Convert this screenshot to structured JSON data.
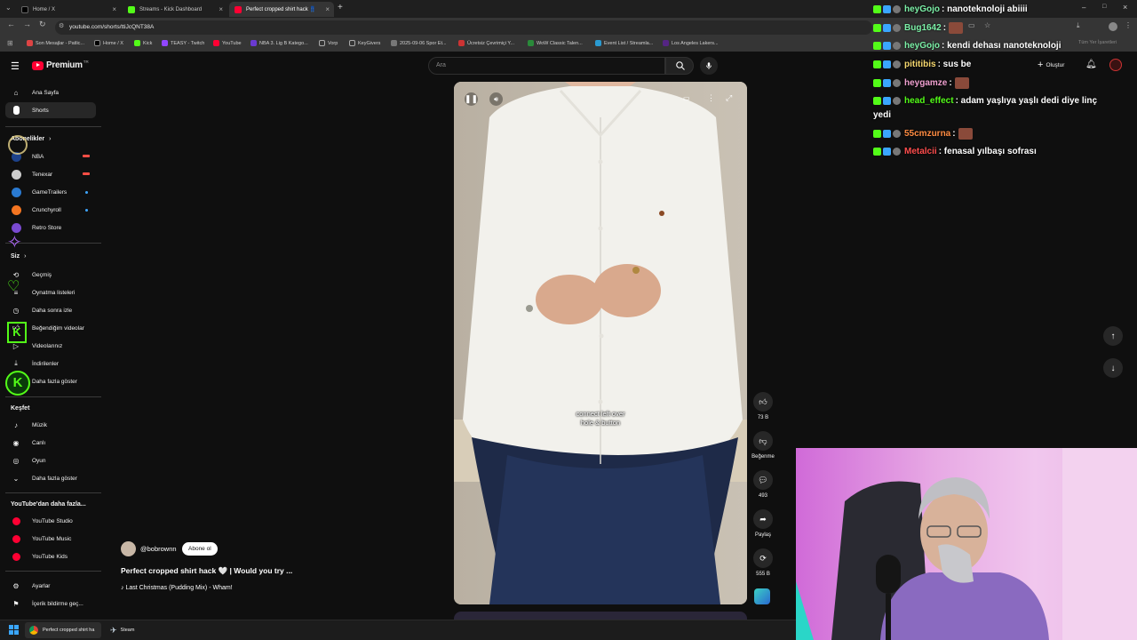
{
  "browser": {
    "tabs": [
      {
        "label": "Home / X",
        "color": "#ffffff"
      },
      {
        "label": "Streams - Kick Dashboard",
        "color": "#53fc18"
      },
      {
        "label": "Perfect cropped shirt hack 👖",
        "color": "#ff0033"
      }
    ],
    "url": "youtube.com/shorts/ttiJcQNT38A",
    "bookmarks": [
      "Son Mesajlar - Patlic...",
      "Home / X",
      "Kick",
      "TEASY - Twitch",
      "YouTube",
      "NBA 3. Lig B Katego...",
      "Vorp",
      "KeyGivers",
      "2025-09-06 Spor Et...",
      "Ücretsiz Çevrimiçi Y...",
      "WoW Classic Talen...",
      "Event List / Streamla...",
      "Los Angeles Lakers...",
      "Tüm Yer İşaretleri"
    ]
  },
  "youtube": {
    "logo_text": "Premium",
    "logo_sup": "TR",
    "search_placeholder": "Ara",
    "create_label": "Oluştur",
    "sidebar": {
      "main": [
        {
          "label": "Ana Sayfa",
          "icon": "home-icon"
        },
        {
          "label": "Shorts",
          "icon": "shorts-icon"
        }
      ],
      "subscriptions_header": "Abonelikler",
      "subscriptions": [
        {
          "label": "NBA",
          "color": "#1d428a",
          "indicator": "live"
        },
        {
          "label": "Tenexar",
          "color": "#cccccc",
          "indicator": "live"
        },
        {
          "label": "GameTrailers",
          "color": "#2a7ad1",
          "indicator": "dot"
        },
        {
          "label": "Crunchyroll",
          "color": "#f47521",
          "indicator": "dot"
        },
        {
          "label": "Retro Store",
          "color": "#7a4ad1",
          "indicator": ""
        }
      ],
      "you_header": "Siz",
      "you": [
        {
          "label": "Geçmiş",
          "icon": "history-icon"
        },
        {
          "label": "Oynatma listeleri",
          "icon": "playlist-icon"
        },
        {
          "label": "Daha sonra izle",
          "icon": "clock-icon"
        },
        {
          "label": "Beğendiğim videolar",
          "icon": "like-icon"
        },
        {
          "label": "Videolarınız",
          "icon": "video-icon"
        },
        {
          "label": "İndirilenler",
          "icon": "download-icon"
        },
        {
          "label": "Daha fazla göster",
          "icon": "chevron-down-icon"
        }
      ],
      "explore_header": "Keşfet",
      "explore": [
        {
          "label": "Müzik",
          "icon": "music-icon"
        },
        {
          "label": "Canlı",
          "icon": "live-icon"
        },
        {
          "label": "Oyun",
          "icon": "gamepad-icon"
        },
        {
          "label": "Daha fazla göster",
          "icon": "chevron-down-icon"
        }
      ],
      "more_header": "YouTube'dan daha fazla...",
      "more": [
        {
          "label": "YouTube Studio"
        },
        {
          "label": "YouTube Music"
        },
        {
          "label": "YouTube Kids"
        }
      ],
      "bottom": [
        {
          "label": "Ayarlar",
          "icon": "gear-icon"
        },
        {
          "label": "İçerik bildirme geç...",
          "icon": "flag-icon"
        }
      ]
    },
    "short": {
      "channel": "@bobrownn",
      "subscribe_label": "Abone ol",
      "title": "Perfect cropped shirt hack 🤍 | Would you try ...",
      "music": "♪ Last Christmas (Pudding Mix) - Wham!",
      "caption_line1": "connect left over",
      "caption_line2": "hole & button",
      "likes": "73 B",
      "dislike_label": "Beğenme",
      "comments": "493",
      "share_label": "Paylaş",
      "remix_count": "555 B"
    }
  },
  "chat": [
    {
      "user": "heyGojo",
      "user_color": "#7cf2a8",
      "message": ": nanoteknoloji abiiii",
      "emote": false
    },
    {
      "user": "Bug1642",
      "user_color": "#7cf2a8",
      "message": ":",
      "emote": true
    },
    {
      "user": "heyGojo",
      "user_color": "#7cf2a8",
      "message": ": kendi dehası nanoteknoloji",
      "emote": false
    },
    {
      "user": "pititibis",
      "user_color": "#f5d76e",
      "message": ": sus be",
      "emote": false
    },
    {
      "user": "heygamze",
      "user_color": "#f0a0d0",
      "message": ":",
      "emote": true
    },
    {
      "user": "head_effect",
      "user_color": "#53fc18",
      "message": ": adam yaşlıya yaşlı dedi diye linç",
      "emote": false
    },
    {
      "user": "",
      "user_color": "#ffffff",
      "message": "yedi",
      "emote": false
    },
    {
      "user": "55cmzurna",
      "user_color": "#ff8c42",
      "message": ":",
      "emote": true
    },
    {
      "user": "Metalcii",
      "user_color": "#ff4d4d",
      "message": ": fenasal yılbaşı sofrası",
      "emote": false
    }
  ],
  "taskbar": {
    "items": [
      "Perfect cropped shirt ha",
      "Steam"
    ]
  }
}
